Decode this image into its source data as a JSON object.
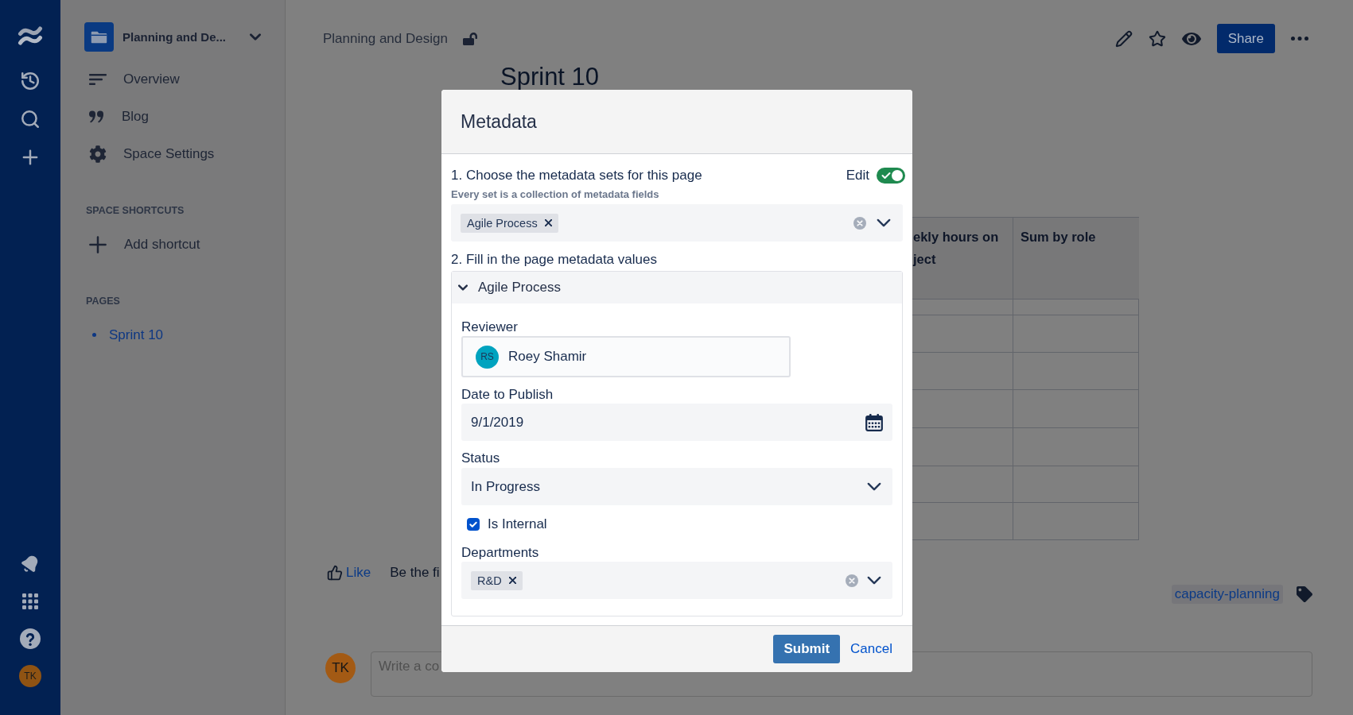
{
  "nav": {
    "avatar": "TK"
  },
  "sidebar": {
    "space_title": "Planning and De...",
    "items": [
      {
        "label": "Overview"
      },
      {
        "label": "Blog"
      },
      {
        "label": "Space Settings"
      }
    ],
    "sections": [
      {
        "heading": "SPACE SHORTCUTS",
        "items": [
          {
            "kind": "action",
            "label": "Add shortcut"
          }
        ]
      },
      {
        "heading": "PAGES",
        "items": [
          {
            "kind": "page",
            "label": "Sprint 10"
          }
        ]
      }
    ]
  },
  "page": {
    "breadcrumb": "Planning and Design",
    "share": "Share",
    "title": "Sprint 10",
    "table": {
      "columns": [
        "ekly hours on ject",
        "Sum by role"
      ]
    },
    "like": {
      "label": "Like",
      "prompt": "Be the fi"
    },
    "labels": [
      "capacity-planning"
    ],
    "comment": {
      "avatar": "TK",
      "placeholder": "Write a co"
    }
  },
  "modal": {
    "title": "Metadata",
    "step1": {
      "heading": "1. Choose the metadata sets for this page",
      "hint": "Every set is a collection of metadata fields",
      "edit": {
        "label": "Edit",
        "on": true
      },
      "sets": [
        "Agile Process"
      ]
    },
    "step2": {
      "heading": "2. Fill in the page metadata values",
      "panels": [
        {
          "title": "Agile Process",
          "expanded": true,
          "fields": [
            {
              "kind": "user",
              "label": "Reviewer",
              "initials": "RS",
              "value": "Roey Shamir"
            },
            {
              "kind": "date",
              "label": "Date to Publish",
              "value": "9/1/2019"
            },
            {
              "kind": "select",
              "label": "Status",
              "value": "In Progress"
            },
            {
              "kind": "checkbox",
              "label": "Is Internal",
              "checked": true
            },
            {
              "kind": "multiselect",
              "label": "Departments",
              "values": [
                "R&D"
              ]
            }
          ]
        }
      ]
    },
    "submit": "Submit",
    "cancel": "Cancel"
  }
}
